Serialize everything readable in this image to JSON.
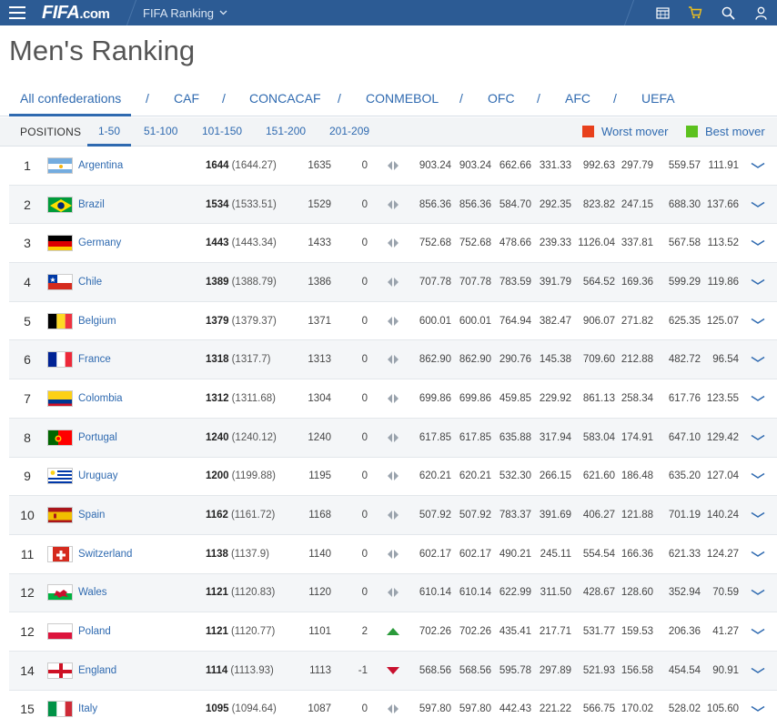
{
  "topbar": {
    "logo_main": "FIFA",
    "logo_suffix": ".com",
    "nav_label": "FIFA Ranking"
  },
  "page_title": "Men's Ranking",
  "confederations": [
    "All confederations",
    "CAF",
    "CONCACAF",
    "CONMEBOL",
    "OFC",
    "AFC",
    "UEFA"
  ],
  "positions": {
    "label": "POSITIONS",
    "ranges": [
      "1-50",
      "51-100",
      "101-150",
      "151-200",
      "201-209"
    ],
    "active": "1-50"
  },
  "legend": {
    "worst_label": "Worst mover",
    "worst_color": "#e8401c",
    "best_label": "Best mover",
    "best_color": "#5cc11e"
  },
  "colors": {
    "topbar": "#2c5b94",
    "link": "#2f6ab0",
    "up": "#2a9a3a",
    "down": "#c8102e"
  },
  "rows": [
    {
      "rank": "1",
      "flag": "argentina",
      "name": "Argentina",
      "pts": "1644",
      "pts_exact": "(1644.27)",
      "prev": "1635",
      "move": "0",
      "trend": "same",
      "vals": [
        "903.24",
        "903.24",
        "662.66",
        "331.33",
        "992.63",
        "297.79",
        "559.57",
        "111.91"
      ]
    },
    {
      "rank": "2",
      "flag": "brazil",
      "name": "Brazil",
      "pts": "1534",
      "pts_exact": "(1533.51)",
      "prev": "1529",
      "move": "0",
      "trend": "same",
      "vals": [
        "856.36",
        "856.36",
        "584.70",
        "292.35",
        "823.82",
        "247.15",
        "688.30",
        "137.66"
      ]
    },
    {
      "rank": "3",
      "flag": "germany",
      "name": "Germany",
      "pts": "1443",
      "pts_exact": "(1443.34)",
      "prev": "1433",
      "move": "0",
      "trend": "same",
      "vals": [
        "752.68",
        "752.68",
        "478.66",
        "239.33",
        "1126.04",
        "337.81",
        "567.58",
        "113.52"
      ]
    },
    {
      "rank": "4",
      "flag": "chile",
      "name": "Chile",
      "pts": "1389",
      "pts_exact": "(1388.79)",
      "prev": "1386",
      "move": "0",
      "trend": "same",
      "vals": [
        "707.78",
        "707.78",
        "783.59",
        "391.79",
        "564.52",
        "169.36",
        "599.29",
        "119.86"
      ]
    },
    {
      "rank": "5",
      "flag": "belgium",
      "name": "Belgium",
      "pts": "1379",
      "pts_exact": "(1379.37)",
      "prev": "1371",
      "move": "0",
      "trend": "same",
      "vals": [
        "600.01",
        "600.01",
        "764.94",
        "382.47",
        "906.07",
        "271.82",
        "625.35",
        "125.07"
      ]
    },
    {
      "rank": "6",
      "flag": "france",
      "name": "France",
      "pts": "1318",
      "pts_exact": "(1317.7)",
      "prev": "1313",
      "move": "0",
      "trend": "same",
      "vals": [
        "862.90",
        "862.90",
        "290.76",
        "145.38",
        "709.60",
        "212.88",
        "482.72",
        "96.54"
      ]
    },
    {
      "rank": "7",
      "flag": "colombia",
      "name": "Colombia",
      "pts": "1312",
      "pts_exact": "(1311.68)",
      "prev": "1304",
      "move": "0",
      "trend": "same",
      "vals": [
        "699.86",
        "699.86",
        "459.85",
        "229.92",
        "861.13",
        "258.34",
        "617.76",
        "123.55"
      ]
    },
    {
      "rank": "8",
      "flag": "portugal",
      "name": "Portugal",
      "pts": "1240",
      "pts_exact": "(1240.12)",
      "prev": "1240",
      "move": "0",
      "trend": "same",
      "vals": [
        "617.85",
        "617.85",
        "635.88",
        "317.94",
        "583.04",
        "174.91",
        "647.10",
        "129.42"
      ]
    },
    {
      "rank": "9",
      "flag": "uruguay",
      "name": "Uruguay",
      "pts": "1200",
      "pts_exact": "(1199.88)",
      "prev": "1195",
      "move": "0",
      "trend": "same",
      "vals": [
        "620.21",
        "620.21",
        "532.30",
        "266.15",
        "621.60",
        "186.48",
        "635.20",
        "127.04"
      ]
    },
    {
      "rank": "10",
      "flag": "spain",
      "name": "Spain",
      "pts": "1162",
      "pts_exact": "(1161.72)",
      "prev": "1168",
      "move": "0",
      "trend": "same",
      "vals": [
        "507.92",
        "507.92",
        "783.37",
        "391.69",
        "406.27",
        "121.88",
        "701.19",
        "140.24"
      ]
    },
    {
      "rank": "11",
      "flag": "switzerland",
      "name": "Switzerland",
      "pts": "1138",
      "pts_exact": "(1137.9)",
      "prev": "1140",
      "move": "0",
      "trend": "same",
      "vals": [
        "602.17",
        "602.17",
        "490.21",
        "245.11",
        "554.54",
        "166.36",
        "621.33",
        "124.27"
      ]
    },
    {
      "rank": "12",
      "flag": "wales",
      "name": "Wales",
      "pts": "1121",
      "pts_exact": "(1120.83)",
      "prev": "1120",
      "move": "0",
      "trend": "same",
      "vals": [
        "610.14",
        "610.14",
        "622.99",
        "311.50",
        "428.67",
        "128.60",
        "352.94",
        "70.59"
      ]
    },
    {
      "rank": "12",
      "flag": "poland",
      "name": "Poland",
      "pts": "1121",
      "pts_exact": "(1120.77)",
      "prev": "1101",
      "move": "2",
      "trend": "up",
      "vals": [
        "702.26",
        "702.26",
        "435.41",
        "217.71",
        "531.77",
        "159.53",
        "206.36",
        "41.27"
      ]
    },
    {
      "rank": "14",
      "flag": "england",
      "name": "England",
      "pts": "1114",
      "pts_exact": "(1113.93)",
      "prev": "1113",
      "move": "-1",
      "trend": "down",
      "vals": [
        "568.56",
        "568.56",
        "595.78",
        "297.89",
        "521.93",
        "156.58",
        "454.54",
        "90.91"
      ]
    },
    {
      "rank": "15",
      "flag": "italy",
      "name": "Italy",
      "pts": "1095",
      "pts_exact": "(1094.64)",
      "prev": "1087",
      "move": "0",
      "trend": "same",
      "vals": [
        "597.80",
        "597.80",
        "442.43",
        "221.22",
        "566.75",
        "170.02",
        "528.02",
        "105.60"
      ]
    }
  ]
}
